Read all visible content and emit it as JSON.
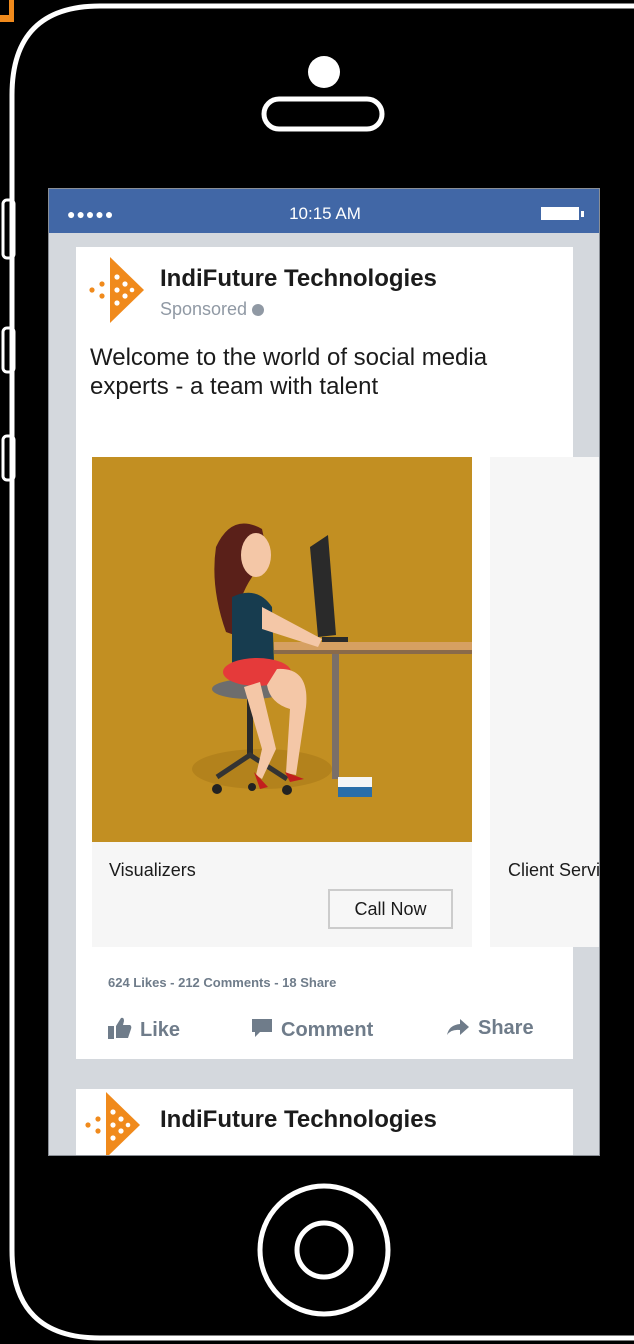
{
  "status_bar": {
    "signal": "●●●●●",
    "time": "10:15 AM"
  },
  "post": {
    "page_name": "IndiFuture Technologies",
    "sponsored": "Sponsored",
    "message": "Welcome to the world of social media experts - a team with talent",
    "carousel": [
      {
        "title": "Visualizers",
        "cta": "Call Now",
        "bg_color": "#c28f22"
      },
      {
        "title": "Client Service",
        "cta": "",
        "bg_color": "#a7a832"
      }
    ],
    "stats": "624 Likes  -  212 Comments  - 18 Share",
    "actions": {
      "like": "Like",
      "comment": "Comment",
      "share": "Share"
    }
  },
  "next_post": {
    "page_name": "IndiFuture Technologies"
  },
  "colors": {
    "status_bar": "#4167a6",
    "brand_orange": "#f08a1c",
    "screen_bg": "#d4d8dd"
  }
}
